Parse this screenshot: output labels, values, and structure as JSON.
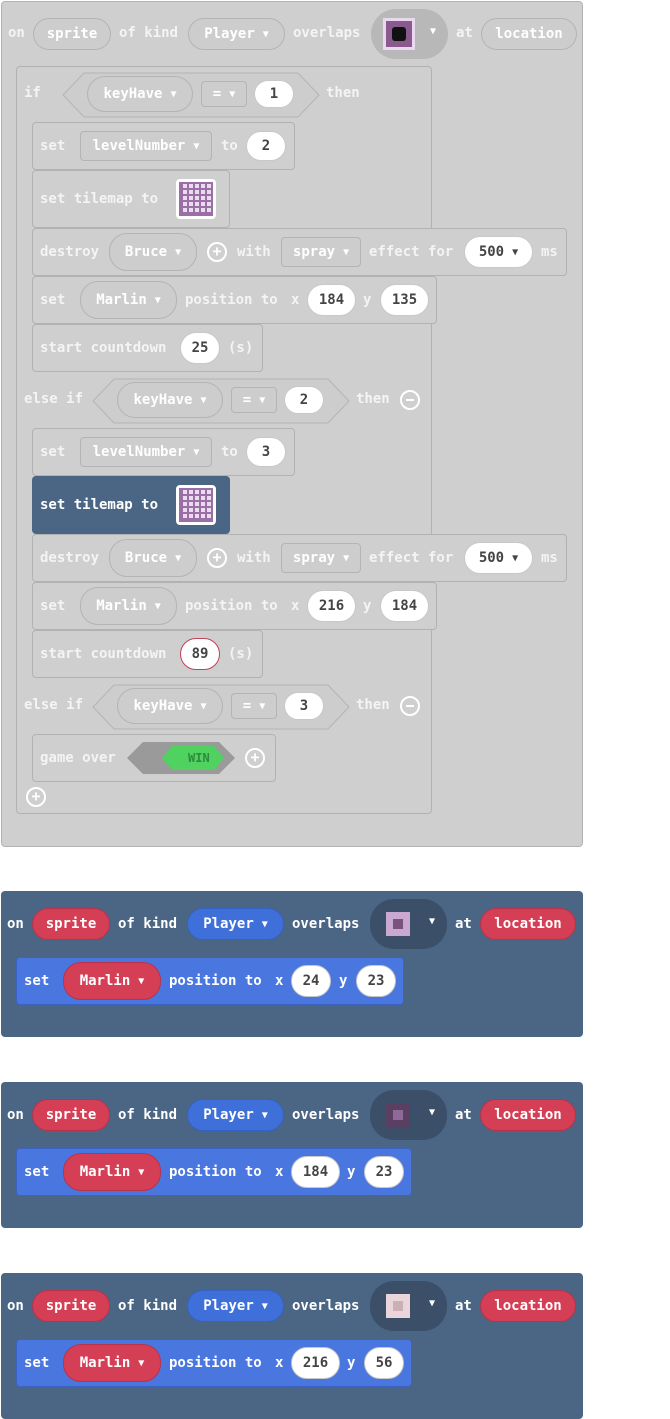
{
  "event_blocks": [
    {
      "on": "on",
      "sprite": "sprite",
      "of_kind": "of kind",
      "kind": "Player",
      "overlaps": "overlaps",
      "at": "at",
      "location": "location",
      "tile_color": "#1a1a1a",
      "tile_fill": "#8a5a8f"
    },
    {
      "on": "on",
      "sprite": "sprite",
      "of_kind": "of kind",
      "kind": "Player",
      "overlaps": "overlaps",
      "at": "at",
      "location": "location",
      "tile_fill": "#7a527e",
      "set": "set",
      "target": "Marlin",
      "position_to": "position to",
      "x": "x",
      "x_val": "24",
      "y": "y",
      "y_val": "23"
    },
    {
      "on": "on",
      "sprite": "sprite",
      "of_kind": "of kind",
      "kind": "Player",
      "overlaps": "overlaps",
      "at": "at",
      "location": "location",
      "tile_fill": "#5b3f63",
      "set": "set",
      "target": "Marlin",
      "position_to": "position to",
      "x": "x",
      "x_val": "184",
      "y": "y",
      "y_val": "23"
    },
    {
      "on": "on",
      "sprite": "sprite",
      "of_kind": "of kind",
      "kind": "Player",
      "overlaps": "overlaps",
      "at": "at",
      "location": "location",
      "tile_fill": "#cbb0b6",
      "set": "set",
      "target": "Marlin",
      "position_to": "position to",
      "x": "x",
      "x_val": "216",
      "y": "y",
      "y_val": "56"
    }
  ],
  "if_block": {
    "if": "if",
    "then": "then",
    "else_if": "else if",
    "var": "keyHave",
    "op": "=",
    "cond1": "1",
    "cond2": "2",
    "cond3": "3"
  },
  "branch1": {
    "set": "set",
    "var": "levelNumber",
    "to": "to",
    "val": "2",
    "tilemap": "set tilemap to",
    "destroy": "destroy",
    "dest_target": "Bruce",
    "with": "with",
    "effect": "spray",
    "effect_for": "effect for",
    "ms_val": "500",
    "ms": "ms",
    "pos_target": "Marlin",
    "position_to": "position to",
    "x": "x",
    "x_val": "184",
    "y": "y",
    "y_val": "135",
    "countdown": "start countdown",
    "count_val": "25",
    "unit": "(s)"
  },
  "branch2": {
    "set": "set",
    "var": "levelNumber",
    "to": "to",
    "val": "3",
    "tilemap": "set tilemap to",
    "destroy": "destroy",
    "dest_target": "Bruce",
    "with": "with",
    "effect": "spray",
    "effect_for": "effect for",
    "ms_val": "500",
    "ms": "ms",
    "pos_target": "Marlin",
    "position_to": "position to",
    "x": "x",
    "x_val": "216",
    "y": "y",
    "y_val": "184",
    "countdown": "start countdown",
    "count_val": "89",
    "unit": "(s)"
  },
  "branch3": {
    "game_over": "game over",
    "result": "WIN"
  },
  "colors": {
    "grey_block": "#cfcfcf",
    "selected_block": "#4b6584",
    "event_block": "#4b6584",
    "sprite_pill": "#d43f55",
    "kind_pill": "#3f6fd8",
    "set_block": "#4a76df",
    "win": "#4fd25f"
  }
}
